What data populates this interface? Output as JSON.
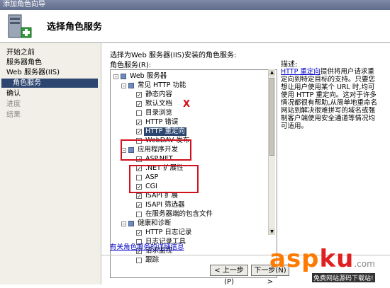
{
  "window": {
    "title": "添加角色向导"
  },
  "header": {
    "title": "选择角色服务"
  },
  "sidebar": {
    "items": [
      {
        "label": "开始之前"
      },
      {
        "label": "服务器角色"
      },
      {
        "label": "Web 服务器(IIS)"
      },
      {
        "label": "角色服务"
      },
      {
        "label": "确认"
      },
      {
        "label": "进度"
      },
      {
        "label": "结果"
      }
    ]
  },
  "main": {
    "intro": "选择为Web 服务器(IIS)安装的角色服务:",
    "list_label": "角色服务(R):",
    "tree": [
      {
        "label": "Web 服务器",
        "check": "partial",
        "expander": "⊟",
        "level": 0
      },
      {
        "label": "常见 HTTP 功能",
        "check": "partial",
        "expander": "⊟",
        "level": 1
      },
      {
        "label": "静态内容",
        "check": "checked",
        "level": 2
      },
      {
        "label": "默认文档",
        "check": "checked",
        "level": 2
      },
      {
        "label": "目录浏览",
        "check": "unchecked",
        "level": 2
      },
      {
        "label": "HTTP 错误",
        "check": "checked",
        "level": 2
      },
      {
        "label": "HTTP 重定向",
        "check": "checked",
        "level": 2,
        "highlight": true
      },
      {
        "label": "WebDAV 发布",
        "check": "unchecked",
        "level": 2
      },
      {
        "label": "应用程序开发",
        "check": "partial",
        "expander": "⊟",
        "level": 1
      },
      {
        "label": "ASP.NET",
        "check": "checked",
        "level": 2
      },
      {
        "label": ".NET 扩展性",
        "check": "checked",
        "level": 2
      },
      {
        "label": "ASP",
        "check": "unchecked",
        "level": 2
      },
      {
        "label": "CGI",
        "check": "checked",
        "level": 2
      },
      {
        "label": "ISAPI 扩展",
        "check": "checked",
        "level": 2
      },
      {
        "label": "ISAPI 筛选器",
        "check": "checked",
        "level": 2
      },
      {
        "label": "在服务器端的包含文件",
        "check": "unchecked",
        "level": 2
      },
      {
        "label": "健康和诊断",
        "check": "partial",
        "expander": "⊟",
        "level": 1
      },
      {
        "label": "HTTP 日志记录",
        "check": "checked",
        "level": 2
      },
      {
        "label": "日志记录工具",
        "check": "unchecked",
        "level": 2
      },
      {
        "label": "请求监视",
        "check": "checked",
        "level": 2
      },
      {
        "label": "跟踪",
        "check": "unchecked",
        "level": 2
      }
    ],
    "description": {
      "title": "描述:",
      "link": "HTTP 重定向",
      "text": "提供将用户请求重定向到特定目标的支持。只要您想让用户使用某个 URL 时,均可使用 HTTP 重定向。这对于许多情况都很有帮助,从简单地重命名网站到解决很难拼写的域名或强制客户端使用安全通道等情况均可适用。"
    },
    "more_link": "有关角色服务的详细信息"
  },
  "footer": {
    "prev_label": "< 上一步(P)",
    "next_label": "下一步(N) >"
  },
  "annotation": {
    "mark": "X"
  },
  "watermark": {
    "brand_left": "asp",
    "brand_right": "ku",
    "brand_suffix": ".com",
    "sub": "免费网站源码下载站!"
  },
  "colors": {
    "selected": "#2c4670",
    "annotation": "#d0101c",
    "wm_orange": "#ff7a00",
    "wm_red": "#e02020"
  }
}
